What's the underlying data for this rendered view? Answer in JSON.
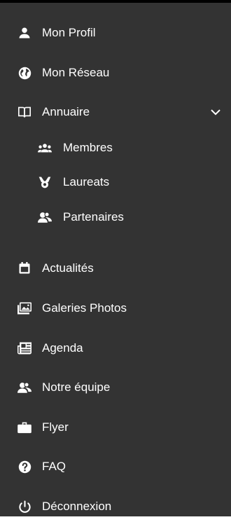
{
  "colors": {
    "background": "#333333",
    "text": "#ffffff",
    "top_border": "#000000"
  },
  "menu": {
    "items": [
      {
        "label": "Mon Profil",
        "icon": "person-icon"
      },
      {
        "label": "Mon Réseau",
        "icon": "globe-icon"
      },
      {
        "label": "Annuaire",
        "icon": "book-open-icon",
        "expanded": true,
        "children": [
          {
            "label": "Membres",
            "icon": "group-icon"
          },
          {
            "label": "Laureats",
            "icon": "trophy-ribbon-icon"
          },
          {
            "label": "Partenaires",
            "icon": "partners-icon"
          }
        ]
      },
      {
        "label": "Actualités",
        "icon": "calendar-icon"
      },
      {
        "label": "Galeries Photos",
        "icon": "photo-gallery-icon"
      },
      {
        "label": "Agenda",
        "icon": "newspaper-icon"
      },
      {
        "label": "Notre équipe",
        "icon": "team-icon"
      },
      {
        "label": "Flyer",
        "icon": "briefcase-icon"
      },
      {
        "label": "FAQ",
        "icon": "question-circle-icon"
      },
      {
        "label": "Déconnexion",
        "icon": "power-icon"
      }
    ]
  }
}
